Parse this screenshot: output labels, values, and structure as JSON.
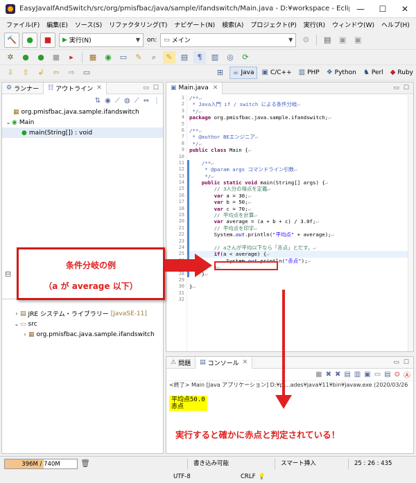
{
  "window": {
    "title": "EasyJavaIfAndSwitch/src/org/pmisfbac/java/sample/ifandswitch/Main.java - D:¥workspace - Eclipse IDE",
    "minimize": "—",
    "maximize": "☐",
    "close": "✕"
  },
  "menu": [
    "ファイル(F)",
    "編集(E)",
    "ソース(S)",
    "リファクタリング(T)",
    "ナビゲート(N)",
    "検索(A)",
    "プロジェクト(P)",
    "実行(R)",
    "ウィンドウ(W)",
    "ヘルプ(H)"
  ],
  "toolbar": {
    "run_combo": "実行(N)",
    "target_combo": "メイン"
  },
  "perspectives": [
    "Java",
    "C/C++",
    "PHP",
    "Python",
    "Perl",
    "Ruby"
  ],
  "left_panel": {
    "tabs": [
      "ランナー",
      "アウトライン"
    ],
    "tree": [
      {
        "label": "org.pmisfbac.java.sample.ifandswitch",
        "indent": 1
      },
      {
        "label": "Main",
        "indent": 0
      },
      {
        "label": "main(String[]) : void",
        "indent": 2
      }
    ],
    "tree_lower": [
      {
        "label": "JRE システム・ライブラリー",
        "suffix": "[JavaSE-11]",
        "indent": 1
      },
      {
        "label": "src",
        "indent": 1
      },
      {
        "label": "org.pmisfbac.java.sample.ifandswitch",
        "indent": 2
      }
    ]
  },
  "editor": {
    "tab": "Main.java",
    "line_numbers": [
      "1",
      "2",
      "3",
      "4",
      "5",
      "6",
      "7",
      "8",
      "9",
      "10",
      "11",
      "12",
      "13",
      "14",
      "15",
      "16",
      "17",
      "18",
      "19",
      "20",
      "21",
      "22",
      "23",
      "24",
      "25",
      "26",
      "27",
      "28",
      "29",
      "30",
      "31",
      "32"
    ],
    "code": [
      "/**",
      " * Java入門 if / switch による条件分岐",
      " */",
      "package org.pmisfbac.java.sample.ifandswitch;",
      "",
      "/**",
      " * @author BEエンジニア",
      " */",
      "public class Main {",
      "",
      "    /**",
      "     * @param args コマンドライン引数",
      "     */",
      "    public static void main(String[] args) {",
      "        // 3人分の得点を定義",
      "        var a = 30;",
      "        var b = 50;",
      "        var c = 70;",
      "        // 平均点を計算",
      "        var average = (a + b + c) / 3.0f;",
      "        // 平均点を印字",
      "        System.out.println(\"平均点\" + average);",
      "",
      "        // aさんが平均以下なら「赤点」とだす。",
      "        if(a < average) {",
      "            System.out.println(\"赤点\");",
      "        }",
      "    }",
      "",
      "}",
      "",
      ""
    ]
  },
  "console": {
    "tabs": [
      "問題",
      "コンソール"
    ],
    "header": "<終了> Main [Java アプリケーション] D:¥pl...ades¥java¥11¥bin¥javaw.exe (2020/03/26",
    "output": [
      "平均点50.0",
      "赤点"
    ]
  },
  "annotations": {
    "callout_title": "条件分岐の例",
    "callout_sub": "（a が average 以下）",
    "result_note": "実行すると確かに赤点と判定されている！"
  },
  "status": {
    "memory": "396M / 740M",
    "memory_fraction": 0.535,
    "writable": "書き込み可能",
    "insert": "スマート挿入",
    "position": "25 : 26 : 435",
    "encoding": "UTF-8",
    "eol": "CRLF"
  },
  "colors": {
    "annotation_red": "#e02020",
    "highlight_yellow": "#ffff00",
    "keyword": "#7f0055",
    "comment": "#3f7f5f"
  }
}
